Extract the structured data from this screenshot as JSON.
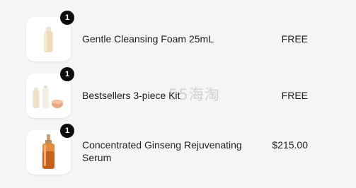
{
  "items": [
    {
      "name": "Gentle Cleansing Foam 25mL",
      "price": "FREE",
      "quantity": "1",
      "image_icon": "cleansing-foam-tube"
    },
    {
      "name": "Bestsellers 3-piece Kit",
      "price": "FREE",
      "quantity": "1",
      "image_icon": "three-piece-kit"
    },
    {
      "name": "Concentrated Ginseng Rejuvenating Serum",
      "price": "$215.00",
      "quantity": "1",
      "image_icon": "serum-dropper-bottle"
    }
  ],
  "watermark": "55海淘",
  "colors": {
    "background": "#f5f5f5",
    "badge": "#0d0d0d",
    "thumb_bg": "#ffffff"
  }
}
